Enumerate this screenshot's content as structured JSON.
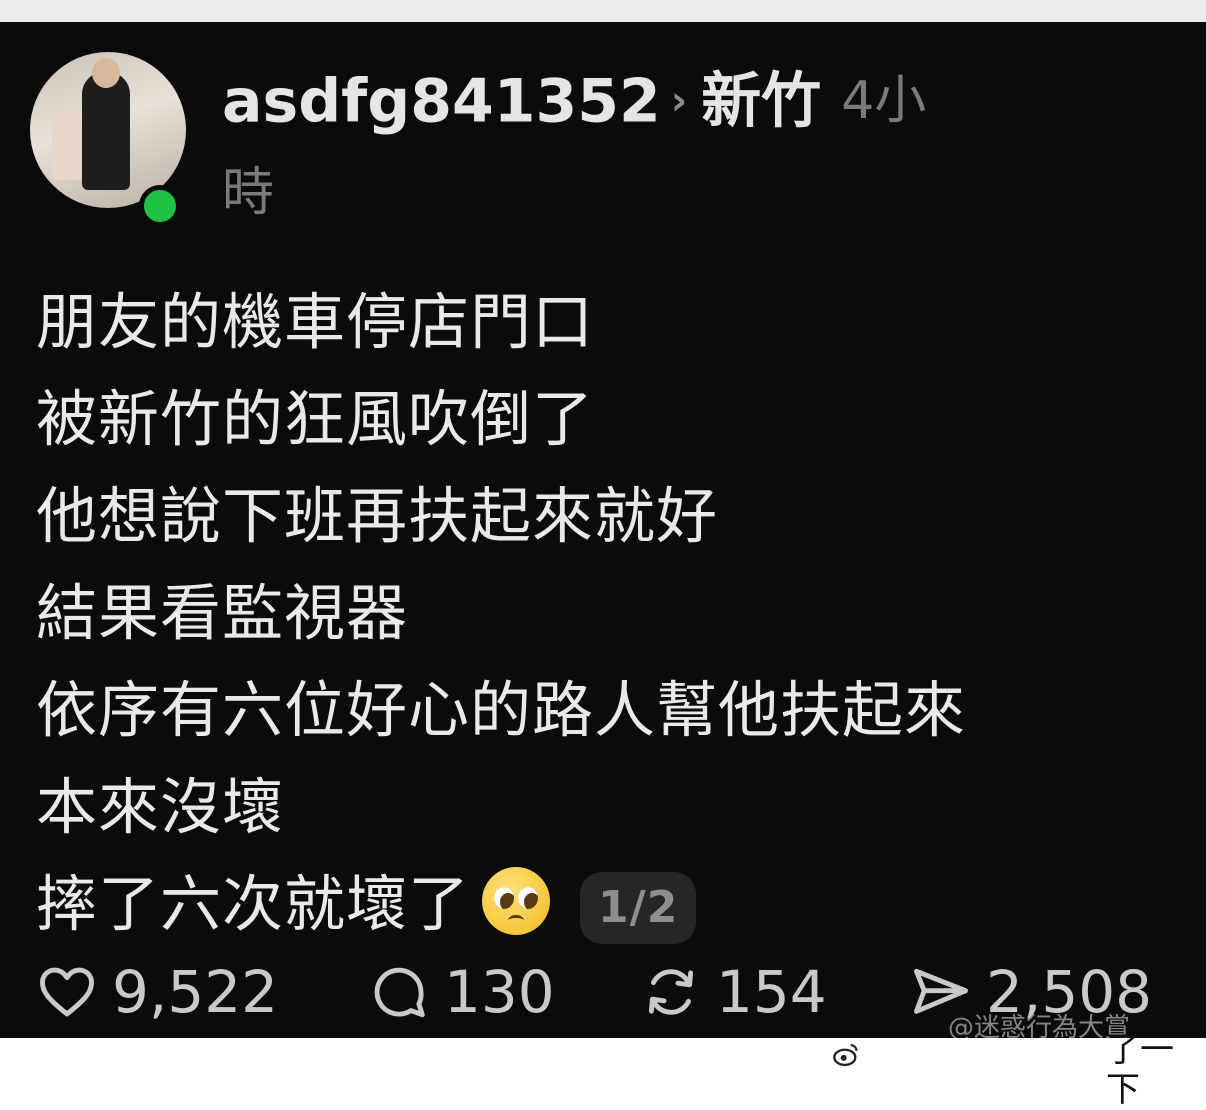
{
  "post": {
    "username": "asdfg841352",
    "chevron": "›",
    "topic": "新竹",
    "time_part1": "4小",
    "time_part2": "時",
    "lines": [
      "朋友的機車停店門口",
      "被新竹的狂風吹倒了",
      "他想說下班再扶起來就好",
      "結果看監視器",
      "依序有六位好心的路人幫他扶起來",
      "本來沒壞",
      "摔了六次就壞了"
    ],
    "emoji": "pleading-face-emoji",
    "page_indicator": "1/2"
  },
  "actions": {
    "likes": "9,522",
    "comments": "130",
    "reposts": "154",
    "shares": "2,508"
  },
  "watermark": "@迷惑行為大賞",
  "bottom_text": "了一下",
  "colors": {
    "background": "#0b0b0b",
    "text": "#e9e9e9",
    "muted": "#7a7a7a",
    "online": "#1dc244"
  },
  "icons": [
    "heart-icon",
    "comment-bubble-icon",
    "repost-icon",
    "share-icon",
    "weibo-logo-icon"
  ]
}
